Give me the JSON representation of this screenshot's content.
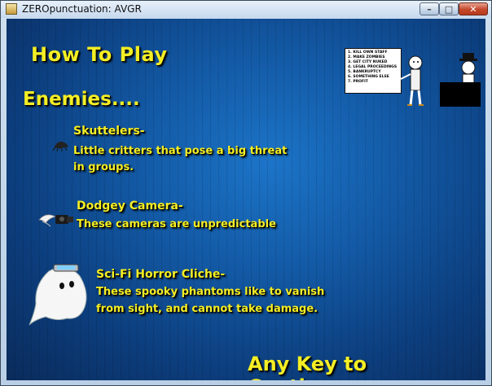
{
  "window": {
    "title": "ZEROpunctuation: AVGR",
    "minimize_glyph": "–",
    "maximize_glyph": "□",
    "close_glyph": "✕"
  },
  "game": {
    "heading": "How To Play",
    "subheading": "Enemies....",
    "enemies": [
      {
        "name": "Skuttelers-",
        "desc_lines": [
          "Little critters that pose a big threat",
          "in groups."
        ],
        "icon": "critter-icon"
      },
      {
        "name": "Dodgey Camera-",
        "desc_lines": [
          "These cameras are unpredictable"
        ],
        "icon": "winged-camera-icon"
      },
      {
        "name": "Sci-Fi Horror Cliche-",
        "desc_lines": [
          "These spooky phantoms like to vanish",
          "from sight, and cannot take damage."
        ],
        "icon": "ghost-icon"
      }
    ],
    "note_list": [
      "1. KILL OWN STAFF",
      "2. MAKE ZOMBIES",
      "3. GET CITY NUKED",
      "4. LEGAL PROCEEDINGS",
      "5. BANKRUPTCY",
      "6. SOMETHING ELSE",
      "7. PROFIT"
    ],
    "continue_text": "Any Key to Continue....."
  },
  "colors": {
    "text_yellow": "#f4ee24",
    "bg_blue": "#135aa6"
  }
}
